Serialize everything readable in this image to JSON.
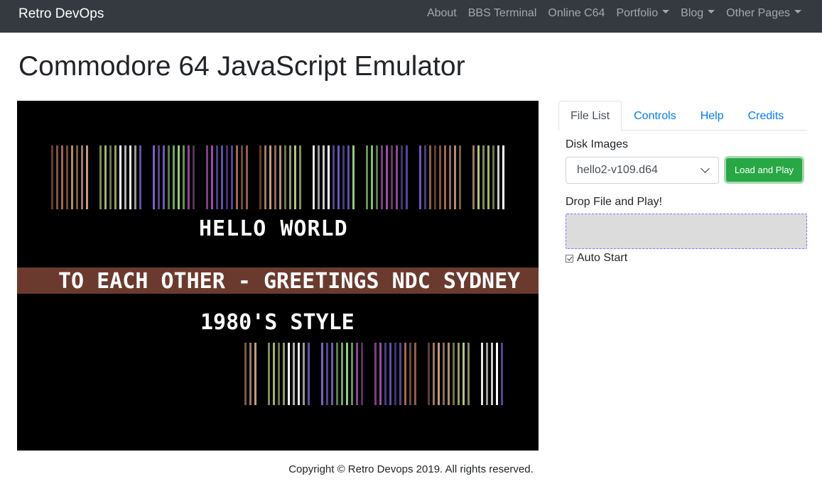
{
  "navbar": {
    "brand": "Retro DevOps",
    "links": [
      {
        "label": "About",
        "dropdown": false
      },
      {
        "label": "BBS Terminal",
        "dropdown": false
      },
      {
        "label": "Online C64",
        "dropdown": false
      },
      {
        "label": "Portfolio",
        "dropdown": true
      },
      {
        "label": "Blog",
        "dropdown": true
      },
      {
        "label": "Other Pages",
        "dropdown": true
      }
    ]
  },
  "page": {
    "title": "Commodore 64 JavaScript Emulator"
  },
  "emulator": {
    "lines": [
      "HELLO WORLD",
      "TO EACH OTHER -   GREETINGS NDC SYDNEY",
      "1980'S STYLE"
    ],
    "band_color": "#6b3a2e",
    "bar_palette": [
      "#a0684e",
      "#c49a7a",
      "#b5c67a",
      "#ffffff",
      "#7b63c9",
      "#8fd07a",
      "#9a4fa0",
      "#6a58b8"
    ]
  },
  "panel": {
    "tabs": [
      "File List",
      "Controls",
      "Help",
      "Credits"
    ],
    "active_tab": "File List",
    "disk_images_label": "Disk Images",
    "selected_disk": "hello2-v109.d64",
    "load_button": "Load and Play",
    "drop_label": "Drop File and Play!",
    "auto_start_label": "Auto Start",
    "auto_start_checked": true
  },
  "footer": {
    "copyright": "Copyright © Retro Devops 2019. All rights reserved."
  }
}
